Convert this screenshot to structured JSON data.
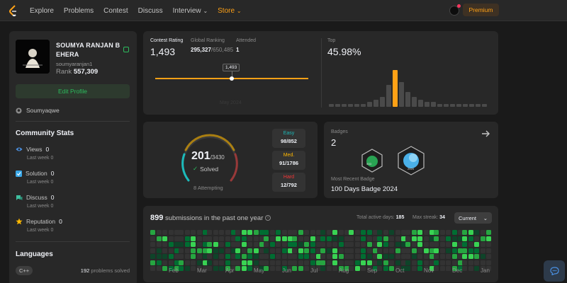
{
  "nav": {
    "links": [
      "Explore",
      "Problems",
      "Contest",
      "Discuss",
      "Interview",
      "Store"
    ],
    "streak_count": "0",
    "premium_label": "Premium"
  },
  "profile": {
    "name": "SOUMYA RANJAN B EHERA",
    "username": "soumyaranjan1",
    "rank_label": "Rank",
    "rank_value": "557,309",
    "edit_label": "Edit Profile",
    "github": "Soumyaqwe"
  },
  "community": {
    "title": "Community Stats",
    "items": [
      {
        "label": "Views",
        "value": "0",
        "sub": "Last week 0",
        "icon": "eye-icon",
        "color": "#4a90e2"
      },
      {
        "label": "Solution",
        "value": "0",
        "sub": "Last week 0",
        "icon": "check-square-icon",
        "color": "#3aa8e8"
      },
      {
        "label": "Discuss",
        "value": "0",
        "sub": "Last week 0",
        "icon": "chat-icon",
        "color": "#3fbf9f"
      },
      {
        "label": "Reputation",
        "value": "0",
        "sub": "Last week 0",
        "icon": "star-icon",
        "color": "#ffb800"
      }
    ]
  },
  "languages": {
    "title": "Languages",
    "lang": "C++",
    "count": "192",
    "count_suffix": "problems solved"
  },
  "contest": {
    "rating_label": "Contest Rating",
    "rating": "1,493",
    "global_label": "Global Ranking",
    "global_value": "295,327",
    "global_total": "/650,485",
    "attended_label": "Attended",
    "attended": "1",
    "tooltip": "1,493",
    "axis_label": "May 2024",
    "top_label": "Top",
    "top_value": "45.98%",
    "histogram": [
      1,
      1,
      1,
      1,
      1,
      1,
      2,
      3,
      4,
      9,
      15,
      10,
      6,
      4,
      3,
      2,
      2,
      1,
      1,
      1,
      1,
      1,
      1,
      1,
      1
    ]
  },
  "solved": {
    "count": "201",
    "total": "/3430",
    "solved_label": "Solved",
    "attempting": "8 Attempting",
    "easy_label": "Easy",
    "easy_value": "98/852",
    "med_label": "Med.",
    "med_value": "91/1786",
    "hard_label": "Hard",
    "hard_value": "12/792",
    "easy_fraction": 0.488,
    "med_fraction": 0.453,
    "hard_fraction": 0.06
  },
  "badges": {
    "label": "Badges",
    "count": "2",
    "recent_label": "Most Recent Badge",
    "recent_name": "100 Days Badge 2024"
  },
  "submissions": {
    "count": "899",
    "text": "submissions in the past one year",
    "active_label": "Total active days:",
    "active_value": "185",
    "streak_label": "Max streak:",
    "streak_value": "34",
    "dropdown": "Current",
    "months": [
      "Feb",
      "Mar",
      "Apr",
      "May",
      "Jun",
      "Jul",
      "Aug",
      "Sep",
      "Oct",
      "Nov",
      "Dec",
      "Jan"
    ]
  }
}
